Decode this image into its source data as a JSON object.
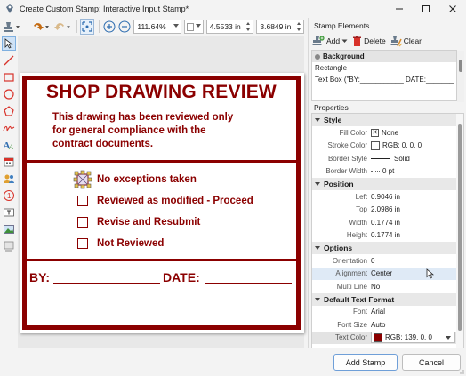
{
  "window": {
    "title": "Create Custom Stamp: Interactive Input Stamp*"
  },
  "toolbar": {
    "zoom": "111.64%",
    "x_value": "4.5533 in",
    "y_value": "3.6849 in"
  },
  "stamp": {
    "title": "SHOP DRAWING REVIEW",
    "body_lines": [
      "This drawing has been reviewed only",
      "for general compliance with the",
      "contract documents."
    ],
    "options": [
      "No exceptions taken",
      "Reviewed as modified - Proceed",
      "Revise and Resubmit",
      "Not Reviewed"
    ],
    "by_label": "BY:",
    "date_label": "DATE:",
    "color": "#8b0000"
  },
  "stamp_elements": {
    "header": "Stamp Elements",
    "add_label": "Add",
    "delete_label": "Delete",
    "clear_label": "Clear",
    "items": [
      {
        "label": "Background",
        "group": true
      },
      {
        "label": "Rectangle",
        "group": false
      },
      {
        "label": "Text Box (\"BY:___________ DATE:_______",
        "group": false
      }
    ]
  },
  "properties": {
    "header": "Properties",
    "groups": {
      "style": "Style",
      "position": "Position",
      "options": "Options",
      "text_format": "Default Text Format"
    },
    "fill_color": {
      "key": "Fill Color",
      "value": "None"
    },
    "stroke_color": {
      "key": "Stroke Color",
      "value": "RGB: 0, 0, 0"
    },
    "border_style": {
      "key": "Border Style",
      "value": "Solid"
    },
    "border_width": {
      "key": "Border Width",
      "value": "0 pt"
    },
    "left": {
      "key": "Left",
      "value": "0.9046 in"
    },
    "top": {
      "key": "Top",
      "value": "2.0986 in"
    },
    "width": {
      "key": "Width",
      "value": "0.1774 in"
    },
    "height": {
      "key": "Height",
      "value": "0.1774 in"
    },
    "orientation": {
      "key": "Orientation",
      "value": "0"
    },
    "alignment": {
      "key": "Alignment",
      "value": "Center"
    },
    "multi_line": {
      "key": "Multi Line",
      "value": "No"
    },
    "font": {
      "key": "Font",
      "value": "Arial"
    },
    "font_size": {
      "key": "Font Size",
      "value": "Auto"
    },
    "text_color": {
      "key": "Text Color",
      "value": "RGB: 139, 0, 0"
    }
  },
  "footer": {
    "add_stamp": "Add Stamp",
    "cancel": "Cancel"
  }
}
